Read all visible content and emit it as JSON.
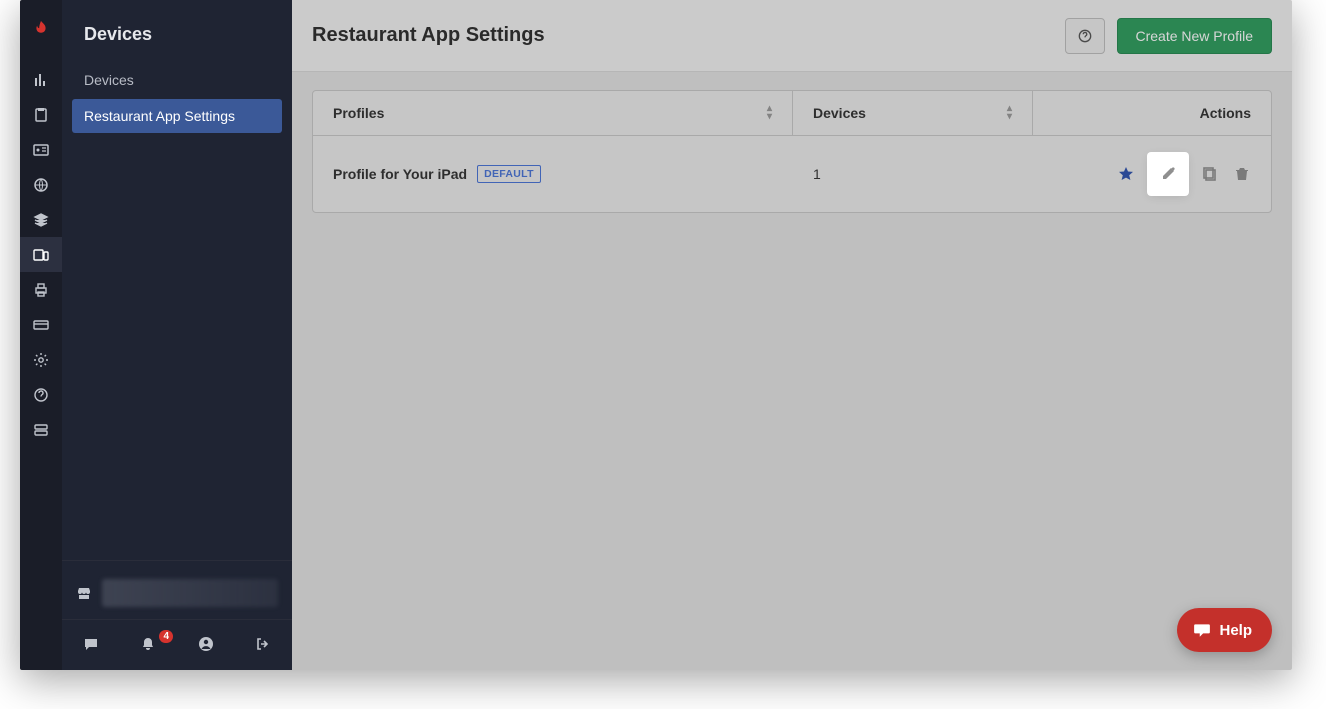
{
  "rail": {
    "items": [
      {
        "name": "analytics-icon"
      },
      {
        "name": "clipboard-icon"
      },
      {
        "name": "id-card-icon"
      },
      {
        "name": "globe-icon"
      },
      {
        "name": "layers-icon"
      },
      {
        "name": "devices-icon",
        "active": true
      },
      {
        "name": "printer-icon"
      },
      {
        "name": "card-icon"
      },
      {
        "name": "gear-icon"
      },
      {
        "name": "help-circle-icon"
      },
      {
        "name": "server-icon"
      }
    ]
  },
  "sidebar": {
    "title": "Devices",
    "items": [
      {
        "label": "Devices",
        "active": false
      },
      {
        "label": "Restaurant App Settings",
        "active": true
      }
    ]
  },
  "bottom": {
    "notification_count": "4"
  },
  "header": {
    "title": "Restaurant App Settings",
    "create_label": "Create New Profile"
  },
  "table": {
    "columns": {
      "profiles": "Profiles",
      "devices": "Devices",
      "actions": "Actions"
    },
    "rows": [
      {
        "name": "Profile for Your iPad",
        "badge": "DEFAULT",
        "devices": "1"
      }
    ]
  },
  "help": {
    "label": "Help"
  }
}
